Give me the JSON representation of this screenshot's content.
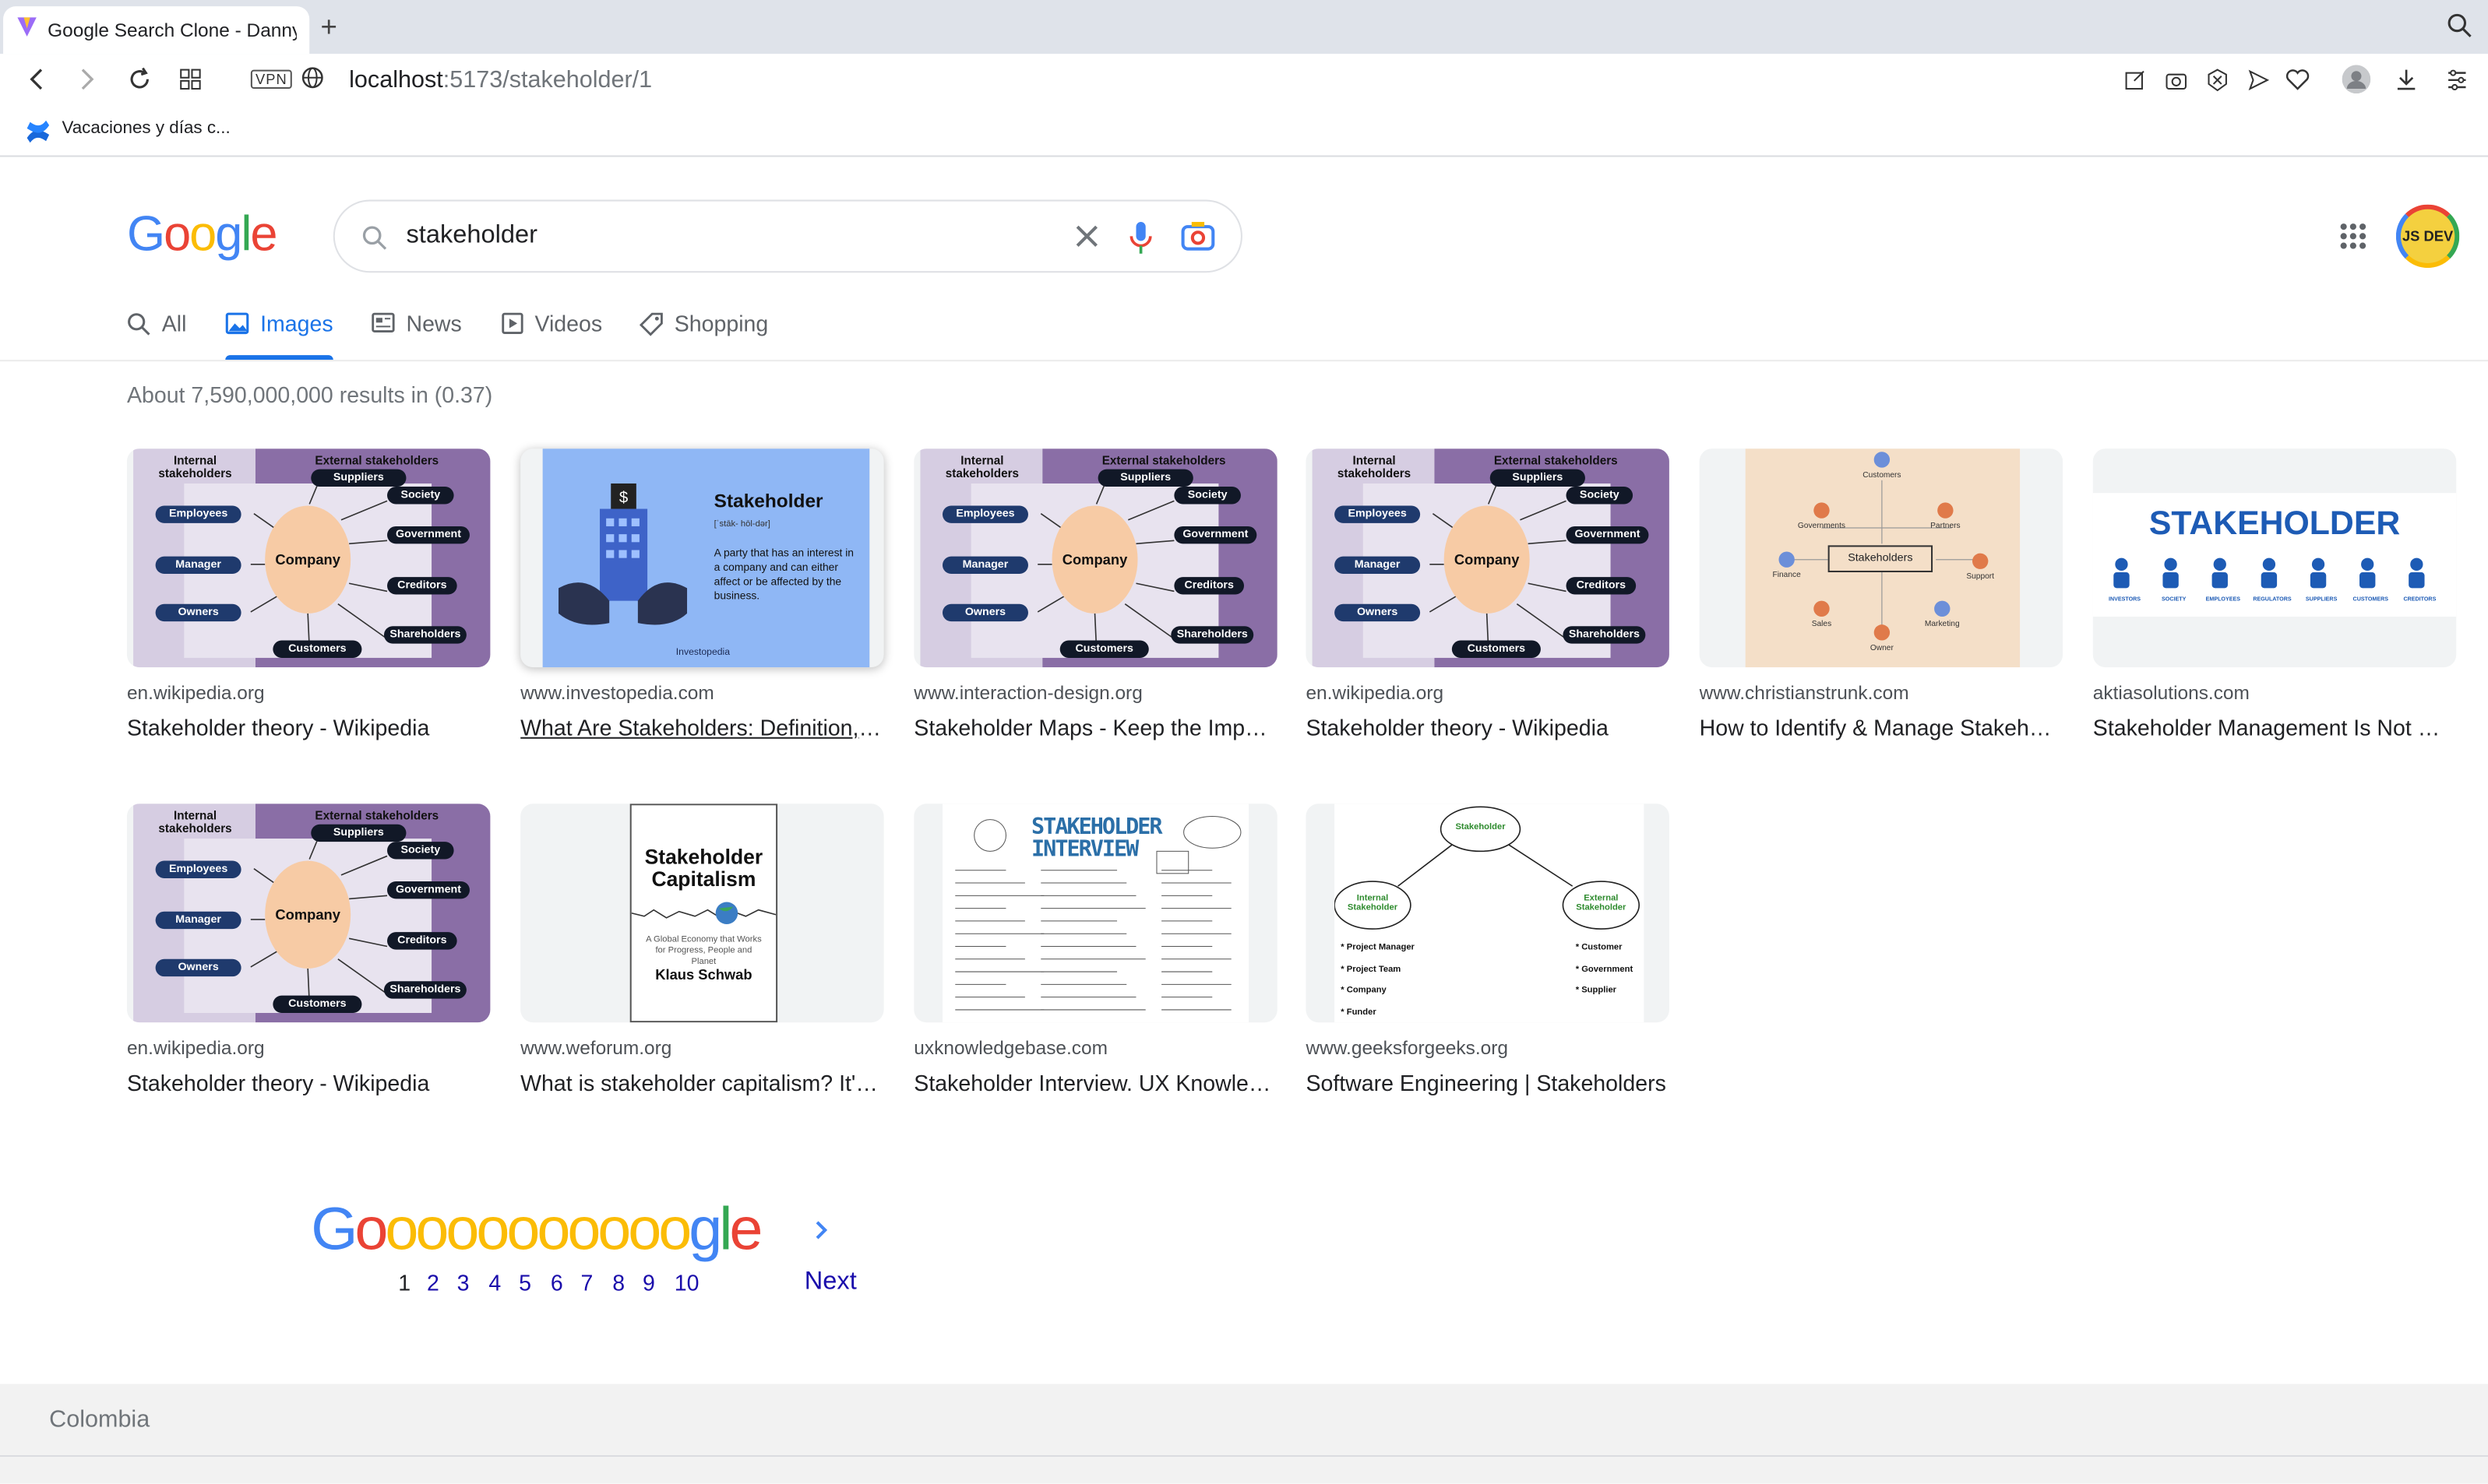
{
  "browser": {
    "tab_title": "Google Search Clone - Danny V",
    "url_host": "localhost",
    "url_path": ":5173/stakeholder/1",
    "vpn_label": "VPN",
    "bookmark": "Vacaciones y días c..."
  },
  "search": {
    "logo_letters": [
      "G",
      "o",
      "o",
      "g",
      "l",
      "e"
    ],
    "query": "stakeholder",
    "avatar_text": "JS DEV"
  },
  "tabs": [
    {
      "label": "All",
      "icon": "search-icon",
      "active": false
    },
    {
      "label": "Images",
      "icon": "image-icon",
      "active": true
    },
    {
      "label": "News",
      "icon": "news-icon",
      "active": false
    },
    {
      "label": "Videos",
      "icon": "video-icon",
      "active": false
    },
    {
      "label": "Shopping",
      "icon": "tag-icon",
      "active": false
    }
  ],
  "stats": "About 7,590,000,000 results in (0.37)",
  "results": [
    {
      "site": "en.wikipedia.org",
      "title": "Stakeholder theory - Wikipedia",
      "thumb": "diagram"
    },
    {
      "site": "www.investopedia.com",
      "title": "What Are Stakeholders: Definition, Types, and Examples",
      "thumb": "investopedia",
      "underline": true
    },
    {
      "site": "www.interaction-design.org",
      "title": "Stakeholder Maps - Keep the Important People Close",
      "thumb": "diagram"
    },
    {
      "site": "en.wikipedia.org",
      "title": "Stakeholder theory - Wikipedia",
      "thumb": "diagram"
    },
    {
      "site": "www.christianstrunk.com",
      "title": "How to Identify & Manage Stakeholders",
      "thumb": "strunk"
    },
    {
      "site": "aktiasolutions.com",
      "title": "Stakeholder Management Is Not What You Think",
      "thumb": "aktia"
    },
    {
      "site": "en.wikipedia.org",
      "title": "Stakeholder theory - Wikipedia",
      "thumb": "diagram"
    },
    {
      "site": "www.weforum.org",
      "title": "What is stakeholder capitalism? It's history and relevance",
      "thumb": "book"
    },
    {
      "site": "uxknowledgebase.com",
      "title": "Stakeholder Interview. UX Knowledge Base Sketch",
      "thumb": "ux"
    },
    {
      "site": "www.geeksforgeeks.org",
      "title": "Software Engineering | Stakeholders",
      "thumb": "gfg"
    }
  ],
  "diagram": {
    "internal": "Internal stakeholders",
    "external": "External stakeholders",
    "center": "Company",
    "left": [
      "Employees",
      "Manager",
      "Owners"
    ],
    "right": [
      "Suppliers",
      "Society",
      "Government",
      "Creditors",
      "Shareholders",
      "Customers"
    ]
  },
  "investopedia": {
    "title": "Stakeholder",
    "phon": "[ˈstāk- hōl-dər]",
    "def": "A party that has an interest in a company and can either affect or be affected by the business.",
    "brand": "Investopedia"
  },
  "strunk": {
    "center": "Stakeholders",
    "nodes": [
      "Customers",
      "Governments",
      "Partners",
      "Finance",
      "Support",
      "Sales",
      "Marketing",
      "Owner"
    ]
  },
  "aktia": {
    "title": "STAKEHOLDER",
    "labels": [
      "INVESTORS",
      "SOCIETY",
      "EMPLOYEES",
      "REGULATORS",
      "SUPPLIERS",
      "CUSTOMERS",
      "CREDITORS"
    ]
  },
  "book": {
    "title": "Stakeholder Capitalism",
    "sub": "A Global Economy that Works for Progress, People and Planet",
    "author": "Klaus Schwab"
  },
  "ux": {
    "title": "STAKEHOLDER INTERVIEW"
  },
  "gfg": {
    "top": "Stakeholder",
    "left": "Internal Stakeholder",
    "right": "External Stakeholder",
    "left_items": [
      "* Project Manager",
      "* Project Team",
      "* Company",
      "* Funder"
    ],
    "right_items": [
      "* Customer",
      "* Government",
      "* Supplier"
    ]
  },
  "pager": {
    "logo_letters": [
      "G",
      "o",
      "o",
      "o",
      "o",
      "o",
      "o",
      "o",
      "o",
      "o",
      "o",
      "o",
      "g",
      "l",
      "e"
    ],
    "pages": [
      "1",
      "2",
      "3",
      "4",
      "5",
      "6",
      "7",
      "8",
      "9",
      "10"
    ],
    "current": "1",
    "next": "Next"
  },
  "footer": {
    "location": "Colombia"
  },
  "colors": {
    "blue": "#4285f4",
    "red": "#ea4335",
    "yellow": "#fbbc05",
    "green": "#34a853",
    "link": "#1a0dab",
    "accent": "#1a73e8"
  }
}
